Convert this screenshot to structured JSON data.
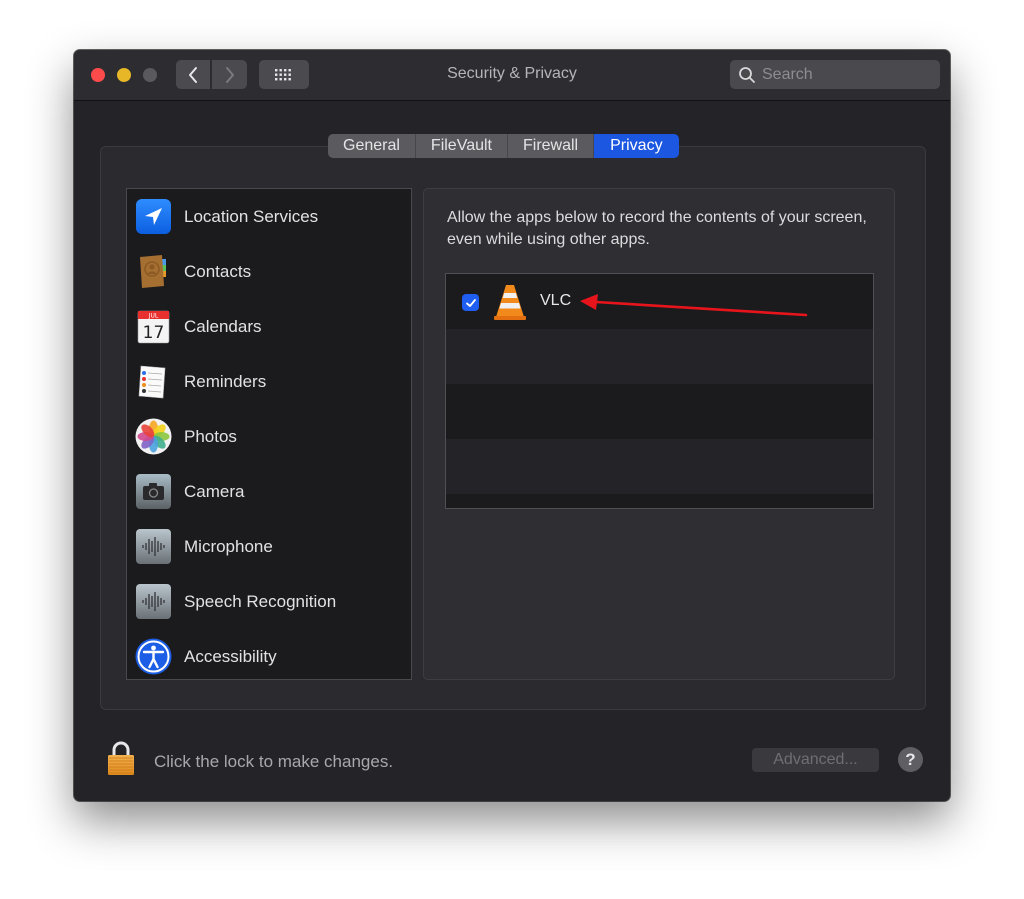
{
  "window": {
    "title": "Security & Privacy"
  },
  "toolbar": {
    "back_icon": "chevron-left-icon",
    "forward_icon": "chevron-right-icon",
    "grid_icon": "show-all-grid-icon",
    "search_placeholder": "Search"
  },
  "tabs": [
    {
      "label": "General",
      "active": false
    },
    {
      "label": "FileVault",
      "active": false
    },
    {
      "label": "Firewall",
      "active": false
    },
    {
      "label": "Privacy",
      "active": true
    }
  ],
  "sidebar": {
    "items": [
      {
        "label": "Location Services",
        "icon": "location-arrow-icon"
      },
      {
        "label": "Contacts",
        "icon": "contacts-book-icon"
      },
      {
        "label": "Calendars",
        "icon": "calendar-icon",
        "icon_month": "JUL",
        "icon_day": "17"
      },
      {
        "label": "Reminders",
        "icon": "reminders-list-icon"
      },
      {
        "label": "Photos",
        "icon": "photos-flower-icon"
      },
      {
        "label": "Camera",
        "icon": "camera-icon"
      },
      {
        "label": "Microphone",
        "icon": "microphone-waveform-icon"
      },
      {
        "label": "Speech Recognition",
        "icon": "speech-waveform-icon"
      },
      {
        "label": "Accessibility",
        "icon": "accessibility-figure-icon"
      }
    ]
  },
  "privacy_panel": {
    "description": "Allow the apps below to record the contents of your screen, even while using other apps.",
    "apps": [
      {
        "name": "VLC",
        "checked": true,
        "icon": "vlc-cone-icon"
      }
    ],
    "annotation": "red-arrow-pointing-to-VLC"
  },
  "footer": {
    "lock_label": "Click the lock to make changes.",
    "advanced_label": "Advanced...",
    "help_label": "?"
  },
  "colors": {
    "accent": "#1b57e0",
    "window_bg": "#242428",
    "annotation_arrow": "#e8141c"
  }
}
